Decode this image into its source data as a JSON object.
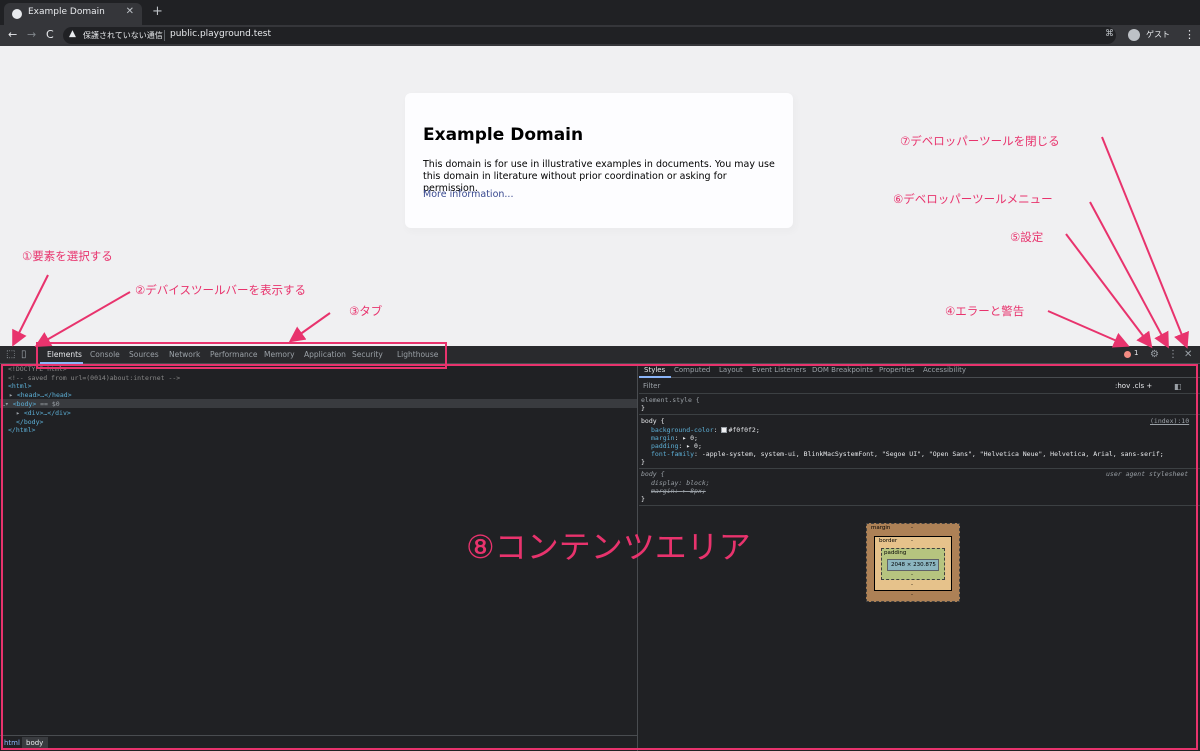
{
  "browser": {
    "tab_title": "Example Domain",
    "tab_close": "✕",
    "new_tab": "+",
    "back": "←",
    "forward": "→",
    "reload": "C",
    "security_label": "保護されていない通信",
    "url": "public.playground.test",
    "profile_label": "ゲスト",
    "menu": "⋮"
  },
  "page": {
    "title": "Example Domain",
    "body_text": "This domain is for use in illustrative examples in documents. You may use this domain in literature without prior coordination or asking for permission.",
    "link_text": "More information..."
  },
  "annotations": {
    "select_element": "①要素を選択する",
    "device_toolbar": "②デバイスツールバーを表示する",
    "tabs": "③タブ",
    "errors_warnings": "④エラーと警告",
    "settings": "⑤設定",
    "devtools_menu": "⑥デベロッパーツールメニュー",
    "close_devtools": "⑦デベロッパーツールを閉じる",
    "content_area": "⑧コンテンツエリア",
    "accent_color": "#e8336d"
  },
  "devtools": {
    "tabs": [
      "Elements",
      "Console",
      "Sources",
      "Network",
      "Performance",
      "Memory",
      "Application",
      "Security",
      "Lighthouse"
    ],
    "active_tab": "Elements",
    "error_count": "1",
    "settings_icon": "⚙",
    "menu_icon": "⋮",
    "close_icon": "✕",
    "elements": {
      "line1": "<!DOCTYPE html>",
      "line2": "<!-- saved from url=(0014)about:internet -->",
      "line3": "<html>",
      "line4_tag": "<head>…</head>",
      "line5_tag": "<body>",
      "line5_sel": " == $0",
      "line6_tag": "<div>…</div>",
      "line7": "</body>",
      "line8": "</html>"
    },
    "breadcrumbs": [
      "html",
      "body"
    ],
    "styles": {
      "tabs": [
        "Styles",
        "Computed",
        "Layout",
        "Event Listeners",
        "DOM Breakpoints",
        "Properties",
        "Accessibility"
      ],
      "filter_placeholder": "Filter",
      "filter_tools": ":hov  .cls  +",
      "element_style": "element.style {",
      "close_brace": "}",
      "rule1_selector": "body {",
      "rule1_source": "(index):10",
      "rule1_props": [
        {
          "name": "background-color",
          "value": "#f0f0f2;"
        },
        {
          "name": "margin",
          "value": "▸ 0;"
        },
        {
          "name": "padding",
          "value": "▸ 0;"
        },
        {
          "name": "font-family",
          "value": "-apple-system, system-ui, BlinkMacSystemFont, \"Segoe UI\", \"Open Sans\", \"Helvetica Neue\", Helvetica, Arial, sans-serif;"
        }
      ],
      "rule2_selector": "body {",
      "rule2_source": "user agent stylesheet",
      "rule2_props": [
        {
          "name": "display",
          "value": "block;"
        },
        {
          "name": "margin",
          "value": "▸ 8px;"
        }
      ],
      "box_model": {
        "margin": "margin",
        "border": "border",
        "padding": "padding",
        "content": "2048 × 230.875",
        "dash": "-"
      }
    }
  }
}
